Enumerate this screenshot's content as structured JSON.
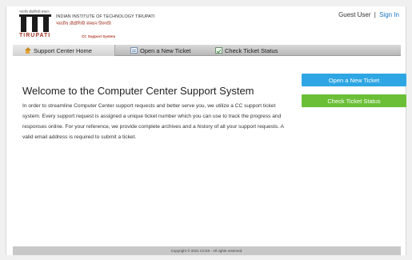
{
  "header": {
    "logo_top_text": "भारतीय प्रौद्योगिकी संस्थान",
    "logo_city": "TIRUPATI",
    "institute_english": "INDIAN INSTITUTE OF TECHNOLOGY TIRUPATI",
    "institute_hindi": "भारतीय प्रौद्योगिकी संस्थान तिरुपति",
    "cc_support": "CC Support System",
    "user_label": "Guest User",
    "separator": "|",
    "sign_in": "Sign In"
  },
  "nav": {
    "items": [
      {
        "label": "Support Center Home",
        "icon": "home-icon"
      },
      {
        "label": "Open a New Ticket",
        "icon": "new-ticket-icon"
      },
      {
        "label": "Check Ticket Status",
        "icon": "ticket-status-icon"
      }
    ]
  },
  "main": {
    "title": "Welcome to the Computer Center Support System",
    "body": "In order to streamline Computer Center support requests and better serve you, we utilize a CC support ticket system. Every support request is assigned a unique ticket number which you can use to track the progress and responses online. For your reference, we provide complete archives and a history of all your support requests. A valid email address is required to submit a ticket."
  },
  "buttons": {
    "open_ticket": "Open a New Ticket",
    "check_status": "Check Ticket Status"
  },
  "footer": {
    "text": "Copyright © 2021 CCSS - All rights reserved."
  },
  "colors": {
    "open_button": "#2ea6e3",
    "check_button": "#6bbf36",
    "brand_red": "#a23524",
    "link": "#1a73c9"
  }
}
